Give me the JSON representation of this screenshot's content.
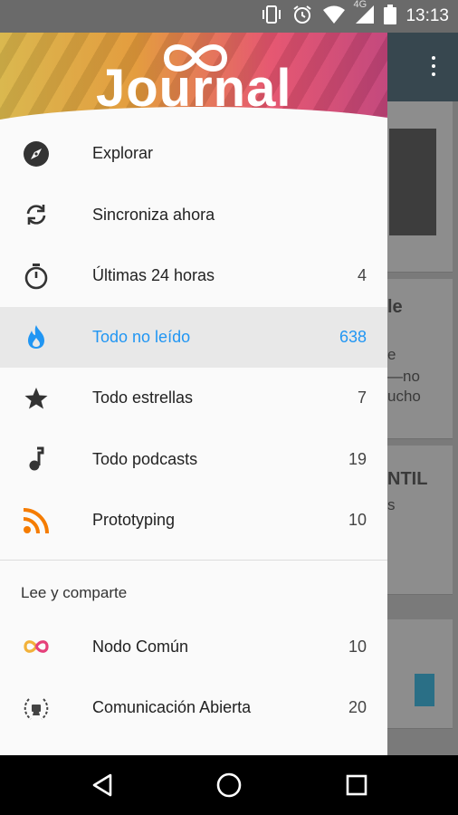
{
  "status_bar": {
    "time": "13:13",
    "network": "4G",
    "icons": [
      "vibrate-icon",
      "alarm-icon",
      "wifi-icon",
      "signal-icon",
      "battery-icon"
    ]
  },
  "header": {
    "logo_text": "Journal"
  },
  "menu": {
    "items": [
      {
        "icon": "compass-icon",
        "label": "Explorar",
        "count": ""
      },
      {
        "icon": "sync-icon",
        "label": "Sincroniza ahora",
        "count": ""
      },
      {
        "icon": "stopwatch-icon",
        "label": "Últimas 24 horas",
        "count": "4"
      },
      {
        "icon": "flame-icon",
        "label": "Todo no leído",
        "count": "638",
        "active": true
      },
      {
        "icon": "star-icon",
        "label": "Todo estrellas",
        "count": "7"
      },
      {
        "icon": "music-note-icon",
        "label": "Todo podcasts",
        "count": "19"
      },
      {
        "icon": "rss-icon",
        "label": "Prototyping",
        "count": "10"
      }
    ],
    "section_title": "Lee y comparte",
    "feeds": [
      {
        "icon": "infinity-logo-icon",
        "label": "Nodo Común",
        "count": "10"
      },
      {
        "icon": "laurel-logo-icon",
        "label": "Comunicación Abierta",
        "count": "20"
      }
    ]
  },
  "background_content": {
    "snippets": [
      "le",
      "e",
      "—no",
      "ucho",
      "NTIL",
      "s"
    ]
  },
  "colors": {
    "accent": "#2196f3",
    "appbar": "#37474f",
    "rss": "#f57c00"
  }
}
